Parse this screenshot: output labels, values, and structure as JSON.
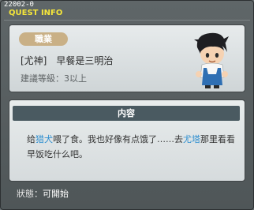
{
  "window": {
    "quest_id": "22002-0",
    "title": "QUEST INFO"
  },
  "quest": {
    "job_label": "職業",
    "name": "[尤神]　早餐是三明治",
    "level": "建議等級：3以上"
  },
  "content": {
    "header": "内容",
    "desc_part1": "给",
    "desc_hl1": "猎犬",
    "desc_part2": "喂了食。我也好像有点饿了……去",
    "desc_hl2": "尤塔",
    "desc_part3": "那里看看早饭吃什么吧。"
  },
  "status": {
    "label": "狀態：",
    "value": "可開始"
  },
  "colors": {
    "title": "#f5e63a",
    "highlight": "#2f8fd0",
    "badge": "#c9b086",
    "header_bar": "#4a5a61"
  },
  "icons": {
    "npc": "npc-portrait-boy"
  }
}
